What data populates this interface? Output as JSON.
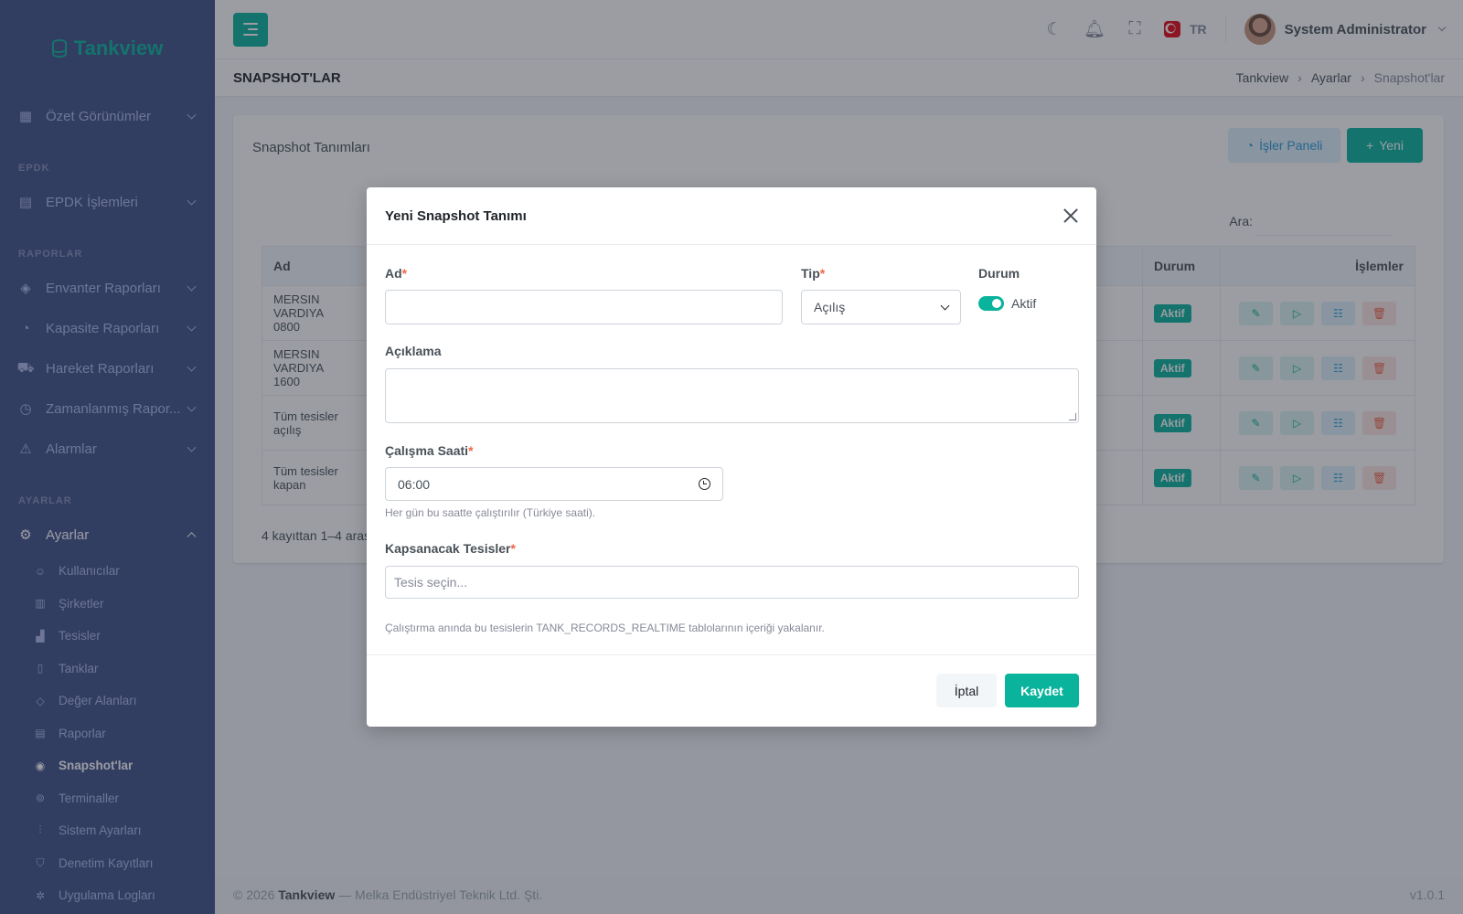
{
  "app": {
    "brand": "Tankview"
  },
  "sidebar": {
    "groups": [
      {
        "title": "",
        "items": [
          {
            "label": "Özet Görünümler",
            "icon": "dashboard-icon"
          }
        ]
      },
      {
        "title": "EPDK",
        "items": [
          {
            "label": "EPDK İşlemleri",
            "icon": "building-icon"
          }
        ]
      },
      {
        "title": "RAPORLAR",
        "items": [
          {
            "label": "Envanter Raporları",
            "icon": "box-icon"
          },
          {
            "label": "Kapasite Raporları",
            "icon": "gauge-icon"
          },
          {
            "label": "Hareket Raporları",
            "icon": "truck-icon"
          },
          {
            "label": "Zamanlanmış Rapor...",
            "icon": "clock-icon"
          },
          {
            "label": "Alarmlar",
            "icon": "alert-icon"
          }
        ]
      },
      {
        "title": "AYARLAR",
        "items": [
          {
            "label": "Ayarlar",
            "icon": "gear-icon"
          }
        ]
      }
    ],
    "sub_items": [
      {
        "label": "Kullanıcılar",
        "icon": "users-icon"
      },
      {
        "label": "Şirketler",
        "icon": "company-icon"
      },
      {
        "label": "Tesisler",
        "icon": "facility-icon"
      },
      {
        "label": "Tanklar",
        "icon": "tank-icon"
      },
      {
        "label": "Değer Alanları",
        "icon": "tag-icon"
      },
      {
        "label": "Raporlar",
        "icon": "report-icon"
      },
      {
        "label": "Snapshot'lar",
        "icon": "camera-icon"
      },
      {
        "label": "Terminaller",
        "icon": "terminal-icon"
      },
      {
        "label": "Sistem Ayarları",
        "icon": "sliders-icon"
      },
      {
        "label": "Denetim Kayıtları",
        "icon": "shield-icon"
      },
      {
        "label": "Uygulama Logları",
        "icon": "bug-icon"
      }
    ]
  },
  "header": {
    "lang": "TR",
    "user_name": "System Administrator"
  },
  "page": {
    "title": "SNAPSHOT'LAR",
    "breadcrumb": [
      "Tankview",
      "Ayarlar",
      "Snapshot'lar"
    ]
  },
  "card": {
    "title": "Snapshot Tanımları",
    "btn_panel": "İşler Paneli",
    "btn_new": "Yeni",
    "search_label": "Ara:",
    "columns": {
      "ad": "Ad",
      "durum": "Durum",
      "islemler": "İşlemler"
    },
    "rows": [
      {
        "ad": "MERSIN VARDIYA",
        "ad2": "0800",
        "durum": "Aktif"
      },
      {
        "ad": "MERSIN VARDIYA",
        "ad2": "1600",
        "durum": "Aktif"
      },
      {
        "ad": "Tüm tesisler açılış",
        "ad2": "",
        "durum": "Aktif"
      },
      {
        "ad": "Tüm tesisler kapan",
        "ad2": "",
        "durum": "Aktif"
      }
    ],
    "info": "4 kayıttan 1–4 aras"
  },
  "modal": {
    "title": "Yeni Snapshot Tanımı",
    "ad_label": "Ad",
    "ad_value": "",
    "tip_label": "Tip",
    "tip_value": "Açılış",
    "durum_label": "Durum",
    "durum_toggle": "Aktif",
    "aciklama_label": "Açıklama",
    "saat_label": "Çalışma Saati",
    "saat_value": "06:00",
    "saat_help": "Her gün bu saatte çalıştırılır (Türkiye saati).",
    "tesis_label": "Kapsanacak Tesisler",
    "tesis_placeholder": "Tesis seçin...",
    "tesis_help": "Çalıştırma anında bu tesislerin TANK_RECORDS_REALTIME tablolarının içeriği yakalanır.",
    "btn_cancel": "İptal",
    "btn_save": "Kaydet"
  },
  "footer": {
    "copyright": "© 2026",
    "brand": "Tankview",
    "company": "— Melka Endüstriyel Teknik Ltd. Şti.",
    "version": "v1.0.1"
  },
  "colors": {
    "primary": "#0ab39c",
    "sidebar": "#405189",
    "danger": "#f06548",
    "info": "#299cdb"
  }
}
